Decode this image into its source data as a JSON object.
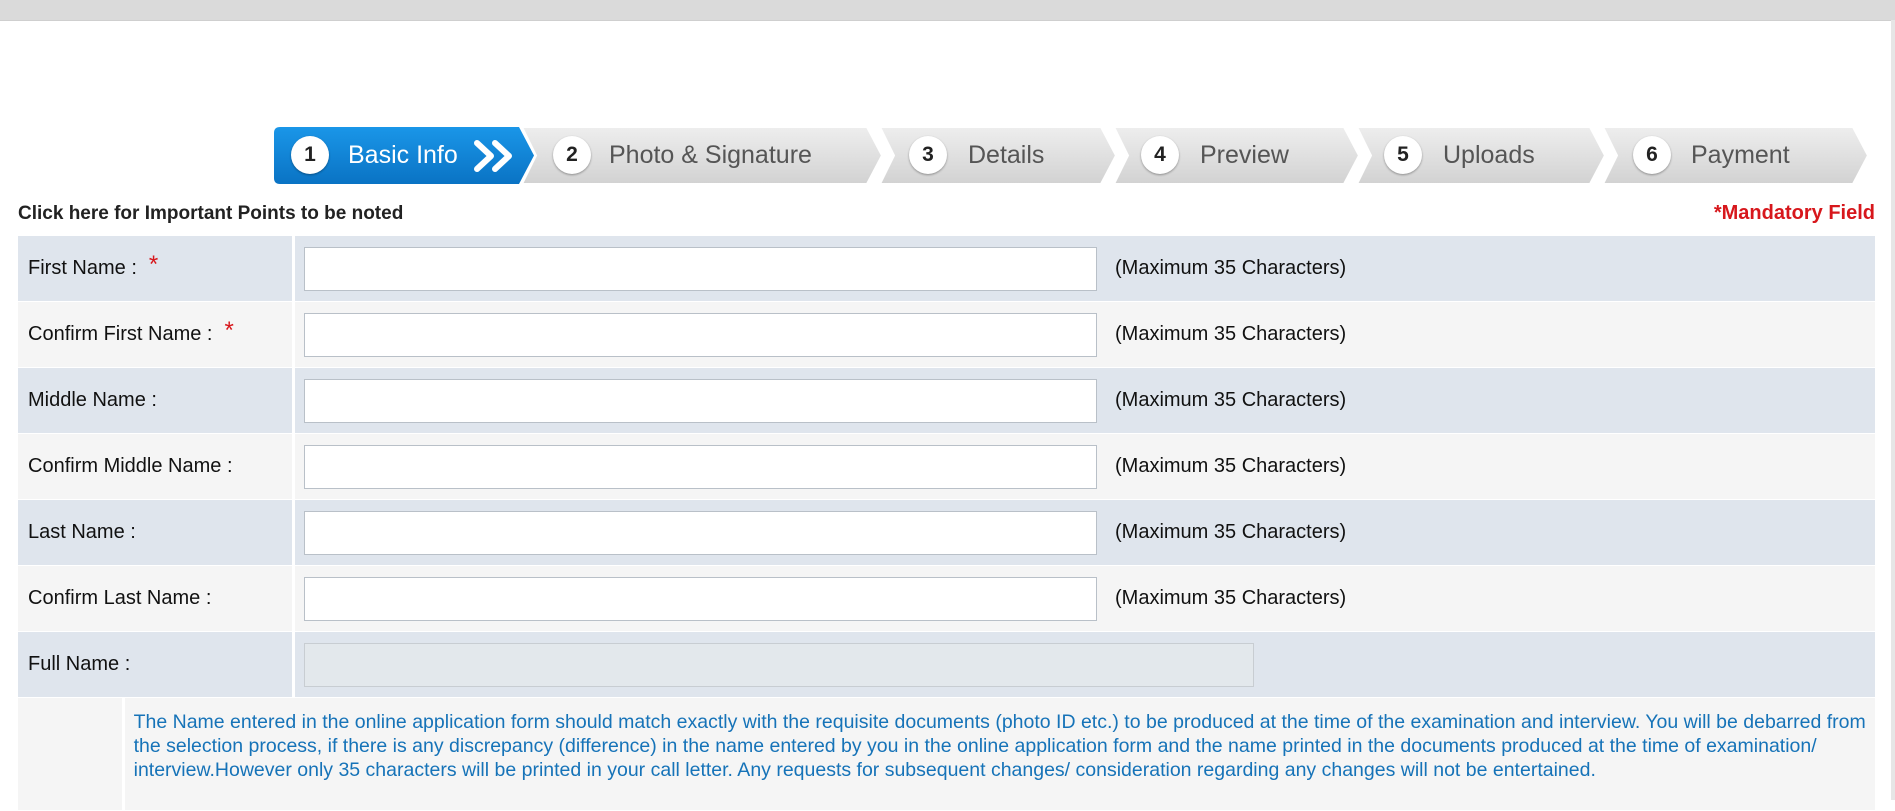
{
  "steps": [
    {
      "number": "1",
      "label": "Basic Info",
      "active": true
    },
    {
      "number": "2",
      "label": "Photo & Signature",
      "active": false
    },
    {
      "number": "3",
      "label": "Details",
      "active": false
    },
    {
      "number": "4",
      "label": "Preview",
      "active": false
    },
    {
      "number": "5",
      "label": "Uploads",
      "active": false
    },
    {
      "number": "6",
      "label": "Payment",
      "active": false
    }
  ],
  "important_points_link": "Click here for Important Points to be noted",
  "mandatory_note": "*Mandatory Field",
  "required_marker": "*",
  "fields": [
    {
      "label": "First Name :",
      "required": true,
      "value": "",
      "hint": "(Maximum 35 Characters)"
    },
    {
      "label": "Confirm First Name :",
      "required": true,
      "value": "",
      "hint": "(Maximum 35 Characters)"
    },
    {
      "label": "Middle Name :",
      "required": false,
      "value": "",
      "hint": "(Maximum 35 Characters)"
    },
    {
      "label": "Confirm Middle Name :",
      "required": false,
      "value": "",
      "hint": "(Maximum 35 Characters)"
    },
    {
      "label": "Last Name :",
      "required": false,
      "value": "",
      "hint": "(Maximum 35 Characters)"
    },
    {
      "label": "Confirm Last Name :",
      "required": false,
      "value": "",
      "hint": "(Maximum 35 Characters)"
    }
  ],
  "full_name": {
    "label": "Full Name :",
    "value": ""
  },
  "name_note": "The Name entered in the online application form should match exactly with the requisite documents (photo ID etc.) to be produced at the time of the examination and interview. You will be debarred from the selection process, if there is any discrepancy (difference) in the name entered by you in the online application form and the name printed in the documents produced at the time of examination/ interview.However only 35 characters will be printed in your call letter. Any requests for subsequent changes/ consideration regarding any changes will not be entertained.",
  "colors": {
    "active_step": "#0f86d6",
    "inactive_step": "#dcdcdc",
    "mandatory_red": "#d7171c",
    "note_blue": "#1673b8",
    "row_blue": "#dfe5ed",
    "row_grey": "#f5f5f5"
  }
}
